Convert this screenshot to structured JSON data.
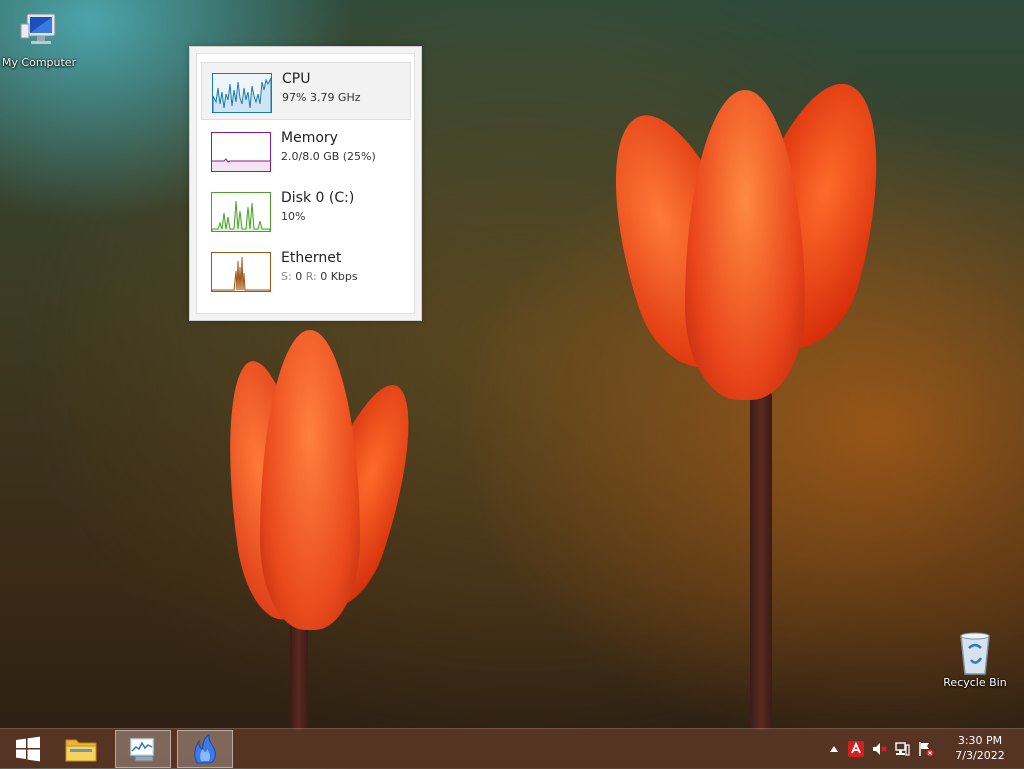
{
  "desktop": {
    "icons": {
      "my_computer": "My Computer",
      "recycle_bin": "Recycle Bin"
    }
  },
  "widget": {
    "metrics": [
      {
        "name": "CPU",
        "value": "97%  3.79 GHz",
        "color": "#1a7ab0"
      },
      {
        "name": "Memory",
        "value": "2.0/8.0 GB (25%)",
        "color": "#8b1a8b"
      },
      {
        "name": "Disk 0 (C:)",
        "value": "10%",
        "color": "#4aa02a"
      },
      {
        "name": "Ethernet",
        "value_send_label": "S:",
        "value_send": "0",
        "value_recv_label": "R:",
        "value_recv": "0 Kbps",
        "color": "#a0581a"
      }
    ]
  },
  "taskbar": {
    "buttons": [
      "start-button",
      "file-explorer",
      "resource-monitor",
      "task-manager-widget"
    ]
  },
  "tray": {
    "time": "3:30 PM",
    "date": "7/3/2022"
  }
}
